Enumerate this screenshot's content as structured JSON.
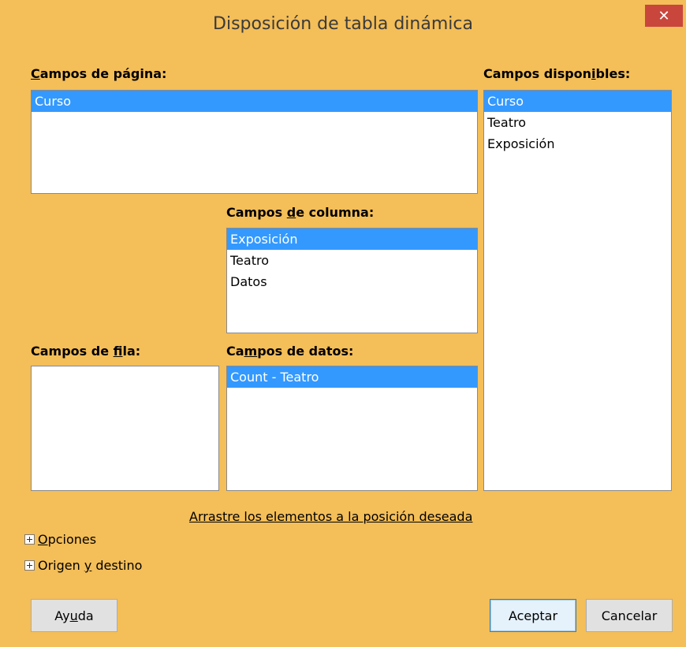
{
  "window": {
    "title": "Disposición de tabla dinámica",
    "close_symbol": "✕"
  },
  "page_fields": {
    "label_pre": "",
    "label_u": "C",
    "label_post": "ampos de página:",
    "items": [
      "Curso"
    ]
  },
  "available_fields": {
    "label_pre": "Campos dispon",
    "label_u": "i",
    "label_post": "bles:",
    "items": [
      "Curso",
      "Teatro",
      "Exposición"
    ]
  },
  "column_fields": {
    "label_pre": "Campos ",
    "label_u": "d",
    "label_post": "e columna:",
    "items": [
      "Exposición",
      "Teatro",
      "Datos"
    ]
  },
  "row_fields": {
    "label_pre": "Campos de ",
    "label_u": "f",
    "label_post": "ila:",
    "items": []
  },
  "data_fields": {
    "label_pre": "Ca",
    "label_u": "m",
    "label_post": "pos de datos:",
    "items": [
      "Count - Teatro"
    ]
  },
  "hint": "Arrastre los elementos a la posición deseada",
  "expanders": {
    "options_u": "O",
    "options_post": "pciones",
    "source_pre": "Origen ",
    "source_u": "y",
    "source_post": " destino"
  },
  "buttons": {
    "help_pre": "Ay",
    "help_u": "u",
    "help_post": "da",
    "ok": "Aceptar",
    "cancel": "Cancelar"
  },
  "colors": {
    "titlebar": "#f4be58",
    "close": "#c9463d",
    "selection": "#3399ff"
  }
}
